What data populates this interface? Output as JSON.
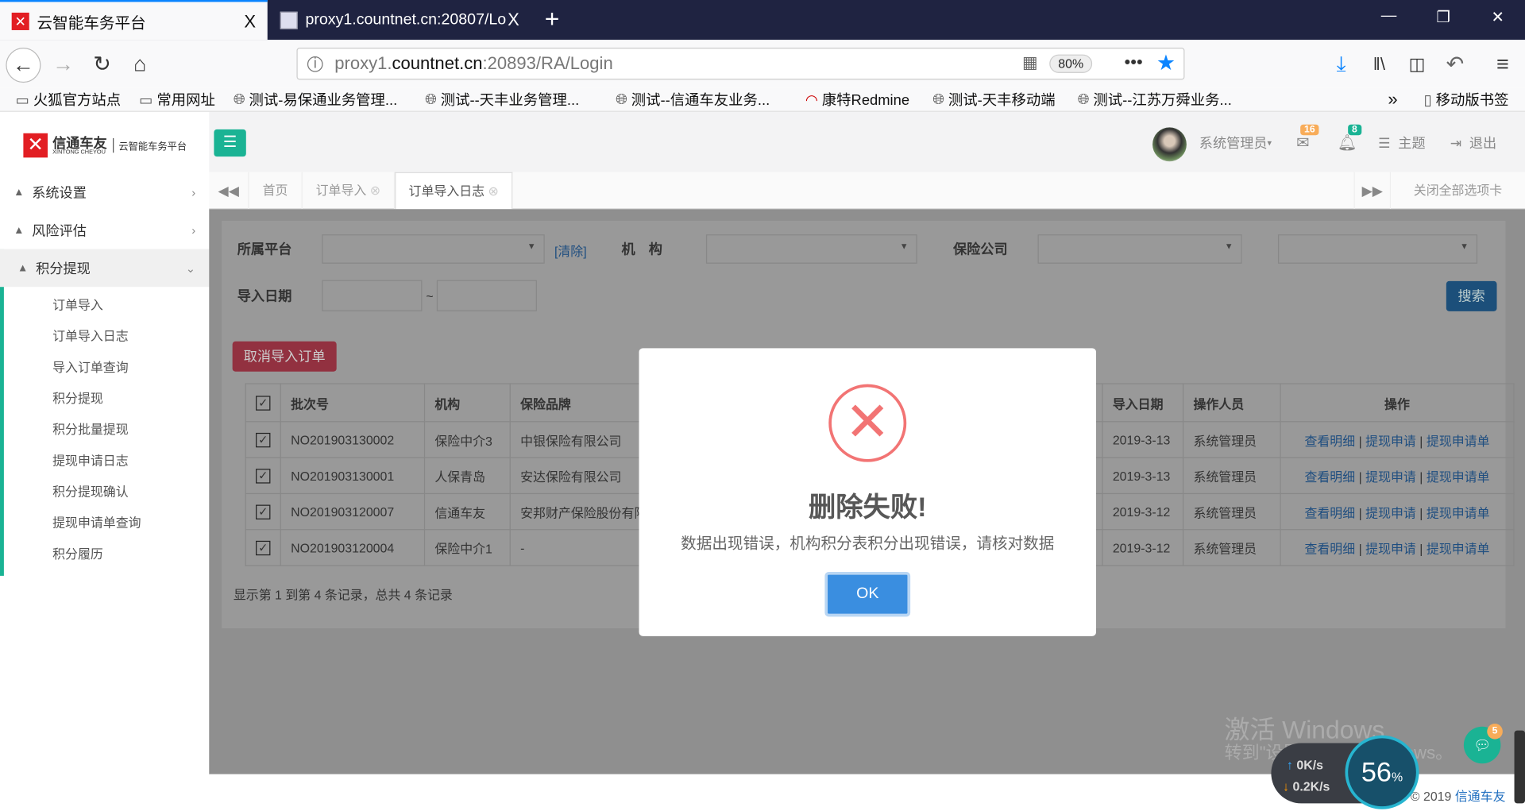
{
  "browser": {
    "tabs": [
      {
        "title": "云智能车务平台",
        "close": "X"
      },
      {
        "title": "proxy1.countnet.cn:20807/Lo",
        "close": "X"
      }
    ],
    "new_tab": "+",
    "window_controls": [
      "—",
      "❐",
      "✕"
    ],
    "url": {
      "prefix": "proxy1.",
      "host": "countnet.cn",
      "suffix": ":20893/RA/Login"
    },
    "zoom": "80%",
    "more": "•••",
    "bookmarks": [
      "火狐官方站点",
      "常用网址",
      "测试-易保通业务管理...",
      "测试--天丰业务管理...",
      "测试--信通车友业务...",
      "康特Redmine",
      "测试-天丰移动端",
      "测试--江苏万舜业务..."
    ],
    "mobile_bookmarks": "移动版书签",
    "overflow": "»"
  },
  "logo": {
    "brand": "信通车友",
    "brand_en": "XINTONG CHEYOU",
    "tagline": "云智能车务平台"
  },
  "sidebar": {
    "menus": [
      {
        "label": "系统设置"
      },
      {
        "label": "风险评估"
      },
      {
        "label": "积分提现"
      }
    ],
    "submenu": [
      "订单导入",
      "订单导入日志",
      "导入订单查询",
      "积分提现",
      "积分批量提现",
      "提现申请日志",
      "积分提现确认",
      "提现申请单查询",
      "积分履历"
    ]
  },
  "header": {
    "user": "系统管理员",
    "mail_count": "16",
    "notify_count": "8",
    "theme": "主题",
    "logout": "退出"
  },
  "page_tabs": {
    "items": [
      {
        "label": "首页"
      },
      {
        "label": "订单导入"
      },
      {
        "label": "订单导入日志"
      }
    ],
    "close_all": "关闭全部选项卡"
  },
  "search": {
    "platform_label": "所属平台",
    "clear": "[清除]",
    "org_label": "机　构",
    "insurer_label": "保险公司",
    "date_label": "导入日期",
    "date_sep": "~",
    "search_button": "搜索"
  },
  "actions": {
    "cancel_import": "取消导入订单"
  },
  "table": {
    "headers": [
      "批次号",
      "机构",
      "保险品牌",
      "",
      "导入日期",
      "操作人员",
      "操作"
    ],
    "rows": [
      {
        "batch": "NO201903130002",
        "org": "保险中介3",
        "brand": "中银保险有限公司",
        "date": "2019-3-13",
        "operator": "系统管理员"
      },
      {
        "batch": "NO201903130001",
        "org": "人保青岛",
        "brand": "安达保险有限公司",
        "date": "2019-3-13",
        "operator": "系统管理员"
      },
      {
        "batch": "NO201903120007",
        "org": "信通车友",
        "brand": "安邦财产保险股份有限公司",
        "date": "2019-3-12",
        "operator": "系统管理员"
      },
      {
        "batch": "NO201903120004",
        "org": "保险中介1",
        "brand": "-",
        "date": "2019-3-12",
        "operator": "系统管理员"
      }
    ],
    "row_actions": [
      "查看明细",
      "提现申请",
      "提现申请单"
    ],
    "sep": "|",
    "summary": "显示第 1 到第 4 条记录，总共 4 条记录"
  },
  "dialog": {
    "title": "删除失败!",
    "message": "数据出现错误，机构积分表积分出现错误，请核对数据",
    "ok": "OK"
  },
  "footer": {
    "copyright": "© 2019",
    "brand": "信通车友"
  },
  "watermark": {
    "line1": "激活 Windows",
    "line2": "转到\"设置\"以激活 Windows。"
  },
  "netmon": {
    "up": "0K/s",
    "down": "0.2K/s",
    "percent": "56",
    "unit": "%"
  },
  "chat_badge": "5"
}
